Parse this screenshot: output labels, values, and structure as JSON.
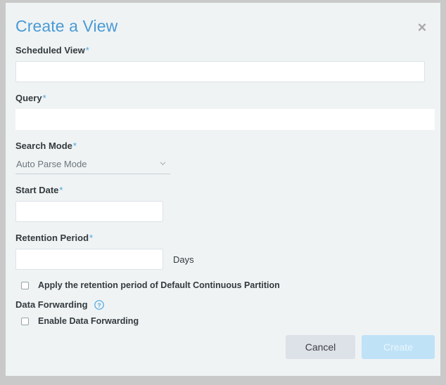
{
  "dialog": {
    "title": "Create a View",
    "close_icon": "close-icon"
  },
  "fields": {
    "scheduled_view": {
      "label": "Scheduled View",
      "required_mark": "*",
      "value": "",
      "placeholder": ""
    },
    "query": {
      "label": "Query",
      "required_mark": "*",
      "value": "",
      "placeholder": ""
    },
    "search_mode": {
      "label": "Search Mode",
      "required_mark": "*",
      "selected": "Auto Parse Mode",
      "options": [
        "Auto Parse Mode"
      ],
      "chevron_icon": "chevron-down-icon"
    },
    "start_date": {
      "label": "Start Date",
      "required_mark": "*",
      "value": "",
      "placeholder": ""
    },
    "retention_period": {
      "label": "Retention Period",
      "required_mark": "*",
      "value": "",
      "placeholder": "",
      "unit": "Days"
    }
  },
  "checkboxes": {
    "apply_retention": {
      "label": "Apply the retention period of Default Continuous Partition",
      "checked": false
    },
    "enable_forwarding": {
      "label": "Enable Data Forwarding",
      "checked": false
    }
  },
  "data_forwarding": {
    "heading": "Data Forwarding",
    "help_icon": "help-circle-icon"
  },
  "footer": {
    "cancel_label": "Cancel",
    "create_label": "Create"
  },
  "colors": {
    "title_blue": "#4a9ad4",
    "required_star": "#49a5e0",
    "dialog_bg": "#eff3f4",
    "page_bg": "#c9c9c9",
    "create_button_bg": "#bfe2f7",
    "cancel_button_bg": "#dde1e8",
    "help_icon_blue": "#49a5e0"
  }
}
